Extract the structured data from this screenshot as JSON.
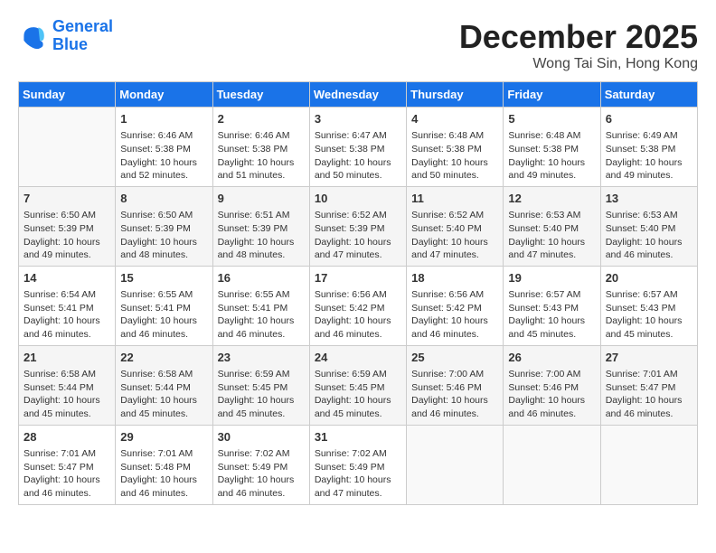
{
  "header": {
    "logo_line1": "General",
    "logo_line2": "Blue",
    "month": "December 2025",
    "location": "Wong Tai Sin, Hong Kong"
  },
  "days_of_week": [
    "Sunday",
    "Monday",
    "Tuesday",
    "Wednesday",
    "Thursday",
    "Friday",
    "Saturday"
  ],
  "weeks": [
    [
      {
        "day": "",
        "info": ""
      },
      {
        "day": "1",
        "info": "Sunrise: 6:46 AM\nSunset: 5:38 PM\nDaylight: 10 hours\nand 52 minutes."
      },
      {
        "day": "2",
        "info": "Sunrise: 6:46 AM\nSunset: 5:38 PM\nDaylight: 10 hours\nand 51 minutes."
      },
      {
        "day": "3",
        "info": "Sunrise: 6:47 AM\nSunset: 5:38 PM\nDaylight: 10 hours\nand 50 minutes."
      },
      {
        "day": "4",
        "info": "Sunrise: 6:48 AM\nSunset: 5:38 PM\nDaylight: 10 hours\nand 50 minutes."
      },
      {
        "day": "5",
        "info": "Sunrise: 6:48 AM\nSunset: 5:38 PM\nDaylight: 10 hours\nand 49 minutes."
      },
      {
        "day": "6",
        "info": "Sunrise: 6:49 AM\nSunset: 5:38 PM\nDaylight: 10 hours\nand 49 minutes."
      }
    ],
    [
      {
        "day": "7",
        "info": "Sunrise: 6:50 AM\nSunset: 5:39 PM\nDaylight: 10 hours\nand 49 minutes."
      },
      {
        "day": "8",
        "info": "Sunrise: 6:50 AM\nSunset: 5:39 PM\nDaylight: 10 hours\nand 48 minutes."
      },
      {
        "day": "9",
        "info": "Sunrise: 6:51 AM\nSunset: 5:39 PM\nDaylight: 10 hours\nand 48 minutes."
      },
      {
        "day": "10",
        "info": "Sunrise: 6:52 AM\nSunset: 5:39 PM\nDaylight: 10 hours\nand 47 minutes."
      },
      {
        "day": "11",
        "info": "Sunrise: 6:52 AM\nSunset: 5:40 PM\nDaylight: 10 hours\nand 47 minutes."
      },
      {
        "day": "12",
        "info": "Sunrise: 6:53 AM\nSunset: 5:40 PM\nDaylight: 10 hours\nand 47 minutes."
      },
      {
        "day": "13",
        "info": "Sunrise: 6:53 AM\nSunset: 5:40 PM\nDaylight: 10 hours\nand 46 minutes."
      }
    ],
    [
      {
        "day": "14",
        "info": "Sunrise: 6:54 AM\nSunset: 5:41 PM\nDaylight: 10 hours\nand 46 minutes."
      },
      {
        "day": "15",
        "info": "Sunrise: 6:55 AM\nSunset: 5:41 PM\nDaylight: 10 hours\nand 46 minutes."
      },
      {
        "day": "16",
        "info": "Sunrise: 6:55 AM\nSunset: 5:41 PM\nDaylight: 10 hours\nand 46 minutes."
      },
      {
        "day": "17",
        "info": "Sunrise: 6:56 AM\nSunset: 5:42 PM\nDaylight: 10 hours\nand 46 minutes."
      },
      {
        "day": "18",
        "info": "Sunrise: 6:56 AM\nSunset: 5:42 PM\nDaylight: 10 hours\nand 46 minutes."
      },
      {
        "day": "19",
        "info": "Sunrise: 6:57 AM\nSunset: 5:43 PM\nDaylight: 10 hours\nand 45 minutes."
      },
      {
        "day": "20",
        "info": "Sunrise: 6:57 AM\nSunset: 5:43 PM\nDaylight: 10 hours\nand 45 minutes."
      }
    ],
    [
      {
        "day": "21",
        "info": "Sunrise: 6:58 AM\nSunset: 5:44 PM\nDaylight: 10 hours\nand 45 minutes."
      },
      {
        "day": "22",
        "info": "Sunrise: 6:58 AM\nSunset: 5:44 PM\nDaylight: 10 hours\nand 45 minutes."
      },
      {
        "day": "23",
        "info": "Sunrise: 6:59 AM\nSunset: 5:45 PM\nDaylight: 10 hours\nand 45 minutes."
      },
      {
        "day": "24",
        "info": "Sunrise: 6:59 AM\nSunset: 5:45 PM\nDaylight: 10 hours\nand 45 minutes."
      },
      {
        "day": "25",
        "info": "Sunrise: 7:00 AM\nSunset: 5:46 PM\nDaylight: 10 hours\nand 46 minutes."
      },
      {
        "day": "26",
        "info": "Sunrise: 7:00 AM\nSunset: 5:46 PM\nDaylight: 10 hours\nand 46 minutes."
      },
      {
        "day": "27",
        "info": "Sunrise: 7:01 AM\nSunset: 5:47 PM\nDaylight: 10 hours\nand 46 minutes."
      }
    ],
    [
      {
        "day": "28",
        "info": "Sunrise: 7:01 AM\nSunset: 5:47 PM\nDaylight: 10 hours\nand 46 minutes."
      },
      {
        "day": "29",
        "info": "Sunrise: 7:01 AM\nSunset: 5:48 PM\nDaylight: 10 hours\nand 46 minutes."
      },
      {
        "day": "30",
        "info": "Sunrise: 7:02 AM\nSunset: 5:49 PM\nDaylight: 10 hours\nand 46 minutes."
      },
      {
        "day": "31",
        "info": "Sunrise: 7:02 AM\nSunset: 5:49 PM\nDaylight: 10 hours\nand 47 minutes."
      },
      {
        "day": "",
        "info": ""
      },
      {
        "day": "",
        "info": ""
      },
      {
        "day": "",
        "info": ""
      }
    ]
  ]
}
